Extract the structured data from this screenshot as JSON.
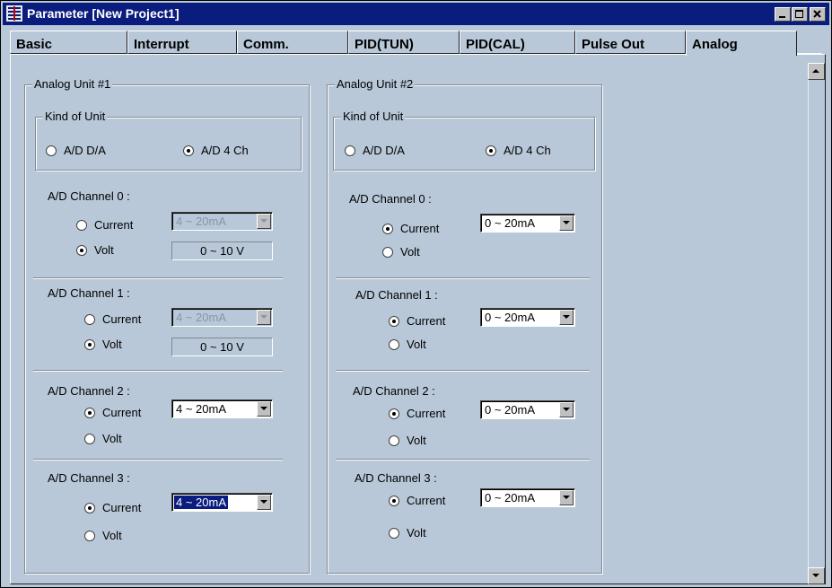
{
  "window": {
    "title": "Parameter [New Project1]"
  },
  "tabs": [
    "Basic",
    "Interrupt",
    "Comm.",
    "PID(TUN)",
    "PID(CAL)",
    "Pulse Out",
    "Analog"
  ],
  "units": [
    {
      "title": "Analog Unit #1",
      "kind_title": "Kind of Unit",
      "kind_options": [
        "A/D D/A",
        "A/D 4 Ch"
      ],
      "channels": [
        {
          "label": "A/D Channel 0 :",
          "current": "Current",
          "volt": "Volt",
          "range": "4 ~ 20mA",
          "volt_range": "0 ~ 10 V"
        },
        {
          "label": "A/D Channel 1 :",
          "current": "Current",
          "volt": "Volt",
          "range": "4 ~ 20mA",
          "volt_range": "0 ~ 10 V"
        },
        {
          "label": "A/D Channel 2 :",
          "current": "Current",
          "volt": "Volt",
          "range": "4 ~ 20mA"
        },
        {
          "label": "A/D Channel 3 :",
          "current": "Current",
          "volt": "Volt",
          "range": "4 ~ 20mA"
        }
      ]
    },
    {
      "title": "Analog Unit #2",
      "kind_title": "Kind of Unit",
      "kind_options": [
        "A/D D/A",
        "A/D 4 Ch"
      ],
      "channels": [
        {
          "label": "A/D  Channel 0 :",
          "current": "Current",
          "volt": "Volt",
          "range": "0 ~ 20mA"
        },
        {
          "label": "A/D  Channel 1 :",
          "current": "Current",
          "volt": "Volt",
          "range": "0 ~ 20mA"
        },
        {
          "label": "A/D Channel 2 :",
          "current": "Current",
          "volt": "Volt",
          "range": "0 ~ 20mA"
        },
        {
          "label": "A/D Channel 3 :",
          "current": "Current",
          "volt": "Volt",
          "range": "0 ~ 20mA"
        }
      ]
    }
  ]
}
